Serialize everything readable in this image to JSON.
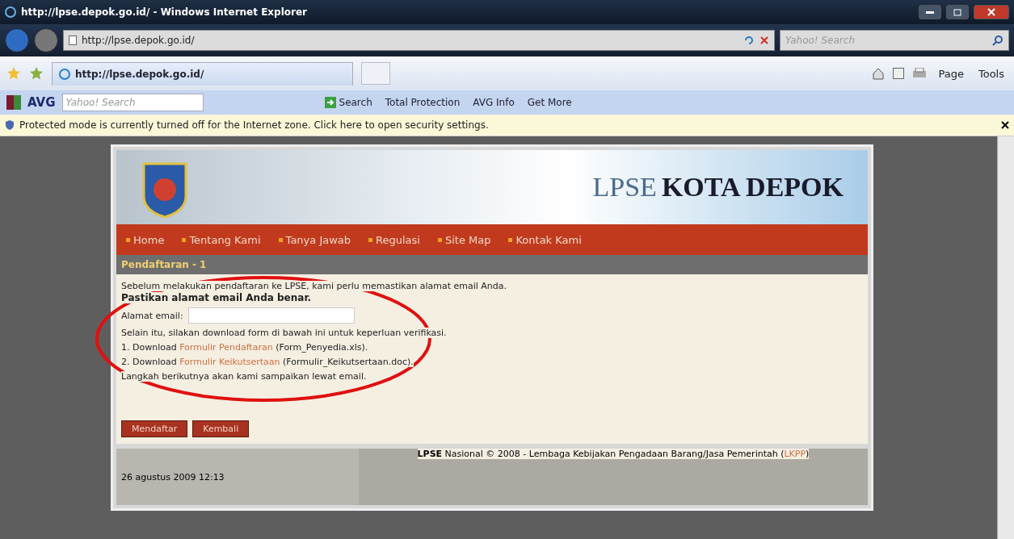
{
  "window": {
    "title": "http://lpse.depok.go.id/ - Windows Internet Explorer"
  },
  "address_bar": {
    "url": "http://lpse.depok.go.id/",
    "search_placeholder": "Yahoo! Search"
  },
  "tab": {
    "title": "http://lpse.depok.go.id/"
  },
  "command_bar": [
    "Page",
    "Tools"
  ],
  "avg_toolbar": {
    "brand": "AVG",
    "search_placeholder": "Yahoo! Search",
    "search_button": "Search",
    "items": [
      "Total Protection",
      "AVG Info",
      "Get More"
    ]
  },
  "info_bar": {
    "message": "Protected mode is currently turned off for the Internet zone.  Click here to open security settings."
  },
  "page": {
    "banner": {
      "title_first": "LPSE",
      "title_second": "KOTA DEPOK"
    },
    "nav": [
      "Home",
      "Tentang Kami",
      "Tanya Jawab",
      "Regulasi",
      "Site Map",
      "Kontak Kami"
    ],
    "section_title": "Pendaftaran - 1",
    "intro": "Sebelum melakukan pendaftaran ke LPSE, kami perlu memastikan alamat email Anda.",
    "emphasis": "Pastikan alamat email Anda benar.",
    "email_label": "Alamat email:",
    "instruction": "Selain itu, silakan download form di bawah ini untuk keperluan verifikasi.",
    "downloads": [
      {
        "prefix": "1. Download",
        "link": "Formulir Pendaftaran",
        "suffix": "(Form_Penyedia.xls)."
      },
      {
        "prefix": "2. Download",
        "link": "Formulir Keikutsertaan",
        "suffix": "(Formulir_Keikutsertaan.doc)."
      }
    ],
    "next_step": "Langkah berikutnya akan kami sampaikan lewat email.",
    "buttons": [
      "Mendaftar",
      "Kembali"
    ],
    "footer": {
      "date": "26 agustus 2009 12:13",
      "credit": "**LPSE** Nasional © 2008 - Lembaga Kebijakan Pengadaan Barang/Jasa Pemerintah (",
      "link": "LKPP",
      "close": ")"
    }
  }
}
